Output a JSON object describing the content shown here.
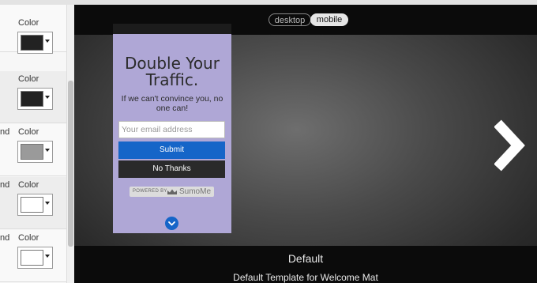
{
  "left_panel": {
    "rows": [
      {
        "clip_label": "",
        "label": "Color",
        "swatch": "#222222"
      },
      {
        "clip_label": "",
        "label": "Color",
        "swatch": "#222222"
      },
      {
        "clip_label": "nd",
        "label": "Color",
        "swatch": "#9a9a9a"
      },
      {
        "clip_label": "nd",
        "label": "Color",
        "swatch": "#ffffff"
      },
      {
        "clip_label": "nd",
        "label": "Color",
        "swatch": "#ffffff"
      }
    ]
  },
  "preview": {
    "view_toggle": {
      "desktop": "desktop",
      "mobile": "mobile",
      "active": "mobile"
    },
    "mobile_card": {
      "headline": "Double Your Traffic.",
      "subheadline": "If we can't convince you, no one can!",
      "email_placeholder": "Your email address",
      "submit_label": "Submit",
      "no_thanks_label": "No Thanks",
      "powered_by": "POWERED BY",
      "brand": "SumoMe"
    },
    "template_name": "Default",
    "template_description": "Default Template for Welcome Mat"
  },
  "colors": {
    "card_background": "#afa7d6",
    "submit_button": "#1565c8",
    "no_thanks_button": "#2a2a2a"
  },
  "icons": [
    "caret-down-icon",
    "next-arrow-icon",
    "crown-icon",
    "chevron-down-icon"
  ]
}
